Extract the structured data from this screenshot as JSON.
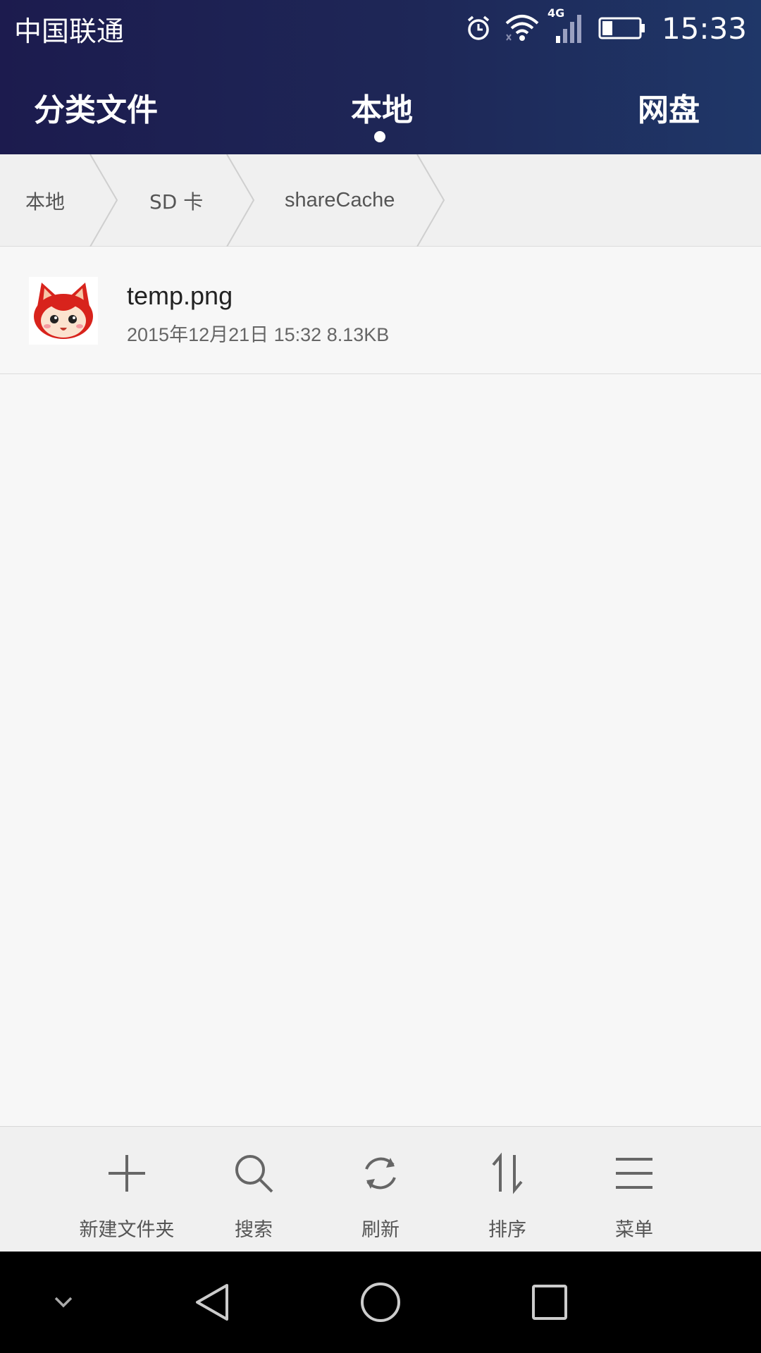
{
  "status_bar": {
    "carrier": "中国联通",
    "network_type": "4G",
    "time": "15:33",
    "icons": [
      "alarm-icon",
      "wifi-icon",
      "signal-icon",
      "battery-icon"
    ]
  },
  "tabs": {
    "classify": "分类文件",
    "local": "本地",
    "cloud": "网盘",
    "active": "local"
  },
  "breadcrumb": [
    "本地",
    "SD 卡",
    "shareCache"
  ],
  "files": [
    {
      "name": "temp.png",
      "meta": "2015年12月21日 15:32 8.13KB",
      "thumb_icon": "fox-avatar-image"
    }
  ],
  "toolbar": {
    "new_folder": "新建文件夹",
    "search": "搜索",
    "refresh": "刷新",
    "sort": "排序",
    "menu": "菜单"
  },
  "navbar": {
    "icons": [
      "chevron-down-icon",
      "back-triangle-icon",
      "home-circle-icon",
      "recent-square-icon"
    ]
  },
  "colors": {
    "header_start": "#1c1b4e",
    "header_end": "#1f3768",
    "background": "#f7f7f7",
    "toolbar_bg": "#f0f0f0",
    "navbar_bg": "#000000"
  }
}
